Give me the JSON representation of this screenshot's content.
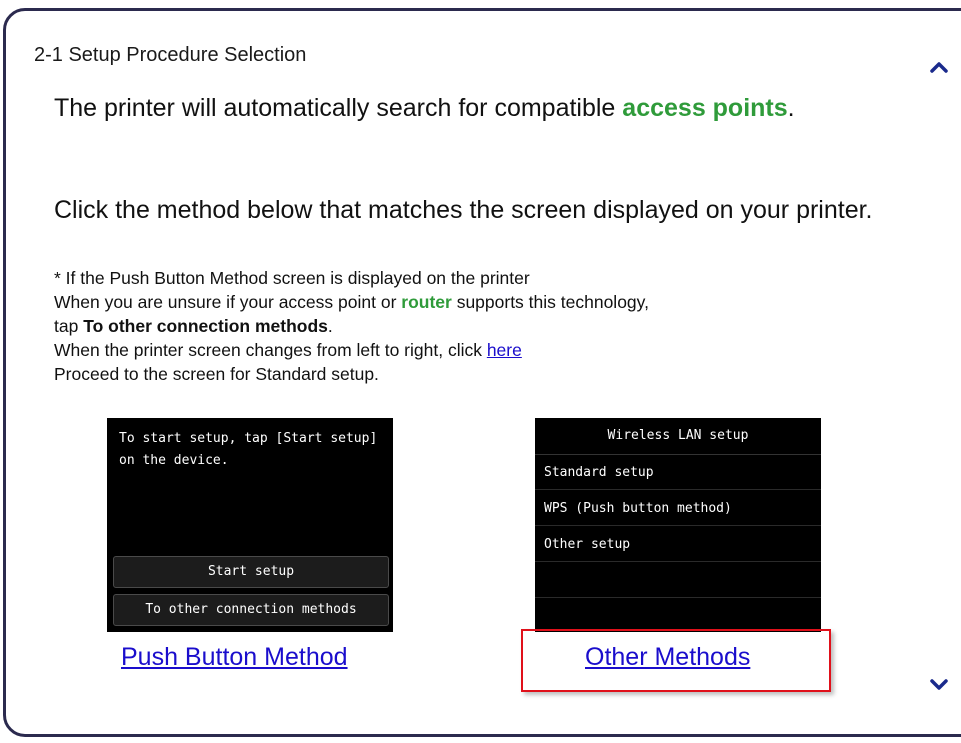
{
  "step_title": "2-1 Setup Procedure Selection",
  "intro": {
    "before": "The printer will automatically search for compatible ",
    "term": "access points",
    "after": "."
  },
  "instruction": "Click the method below that matches the screen displayed on your printer.",
  "notes": {
    "line1": "* If the Push Button Method screen is displayed on the printer",
    "line2_before": "When you are unsure if your access point or ",
    "line2_term": "router",
    "line2_after": " supports this technology,",
    "line3_before": "tap ",
    "line3_bold": "To other connection methods",
    "line3_after": ".",
    "line4_before": "When the printer screen changes from left to right, click ",
    "line4_link": "here",
    "line5": "Proceed to the screen for Standard setup."
  },
  "screen_push": {
    "message": "To start setup, tap [Start setup] on the device.",
    "button1": "Start setup",
    "button2": "To other connection methods"
  },
  "screen_other": {
    "header": "Wireless LAN setup",
    "items": [
      "Standard setup",
      "WPS (Push button method)",
      "Other setup"
    ]
  },
  "links": {
    "push": "Push Button Method",
    "other": "Other Methods"
  },
  "colors": {
    "accent_green": "#2f9b3a",
    "link_blue": "#1a0dcc",
    "highlight_red": "#e0101a",
    "frame": "#2b2a4e"
  },
  "icons": {
    "scroll_up": "chevron-up-icon",
    "scroll_down": "chevron-down-icon"
  }
}
